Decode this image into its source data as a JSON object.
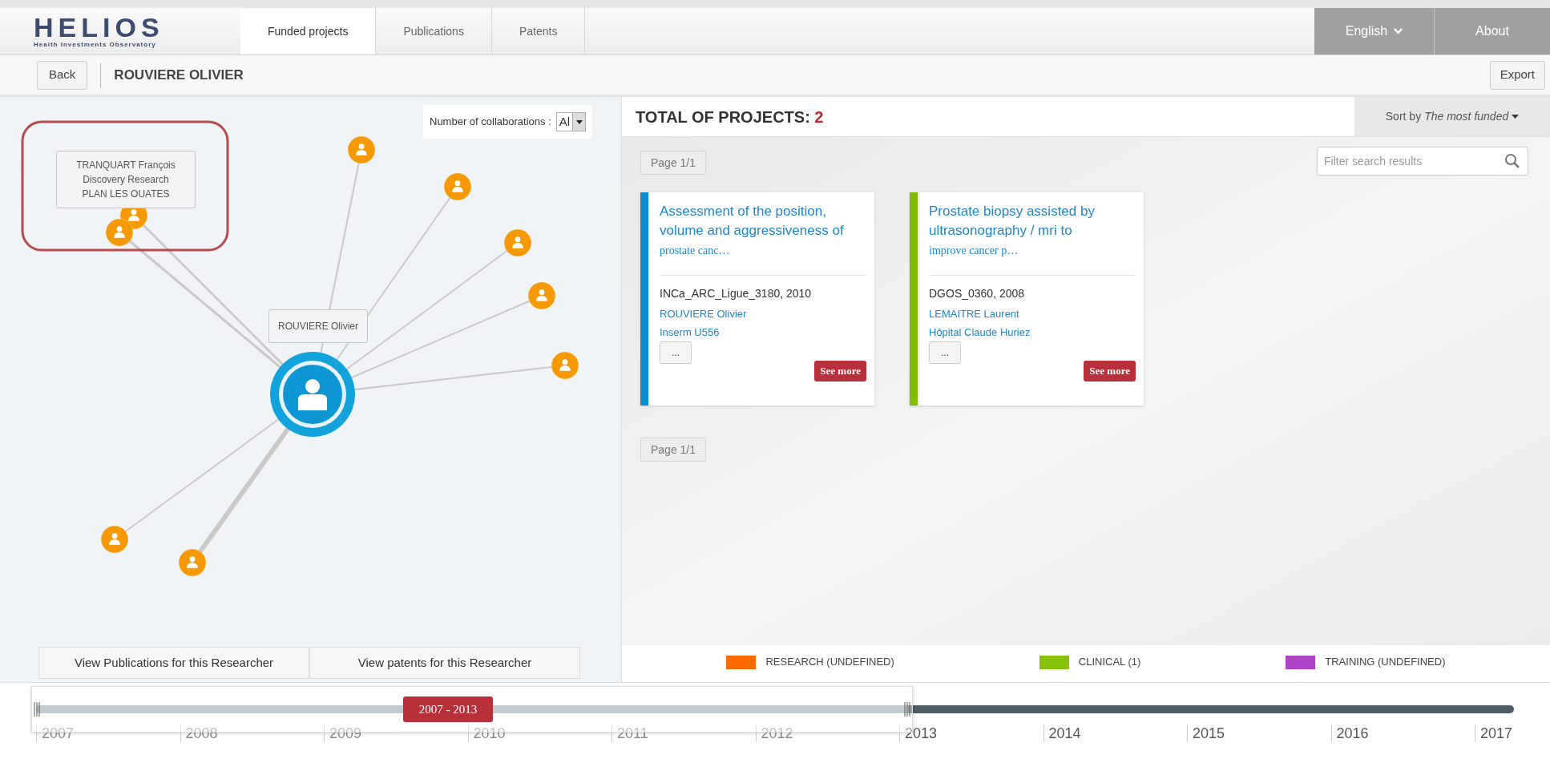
{
  "logo": {
    "name": "HELIOS",
    "tagline": "Health Investments Observatory"
  },
  "tabs": [
    {
      "label": "Funded projects",
      "selected": true
    },
    {
      "label": "Publications",
      "selected": false
    },
    {
      "label": "Patents",
      "selected": false
    }
  ],
  "language": "English",
  "about": "About",
  "subbar": {
    "back": "Back",
    "title": "ROUVIERE OLIVIER",
    "export": "Export"
  },
  "graph": {
    "filter_label": "Number of collaborations :",
    "filter_value": "Al",
    "center_label": "ROUVIERE Olivier",
    "tooltip": [
      "TRANQUART François",
      "Discovery Research",
      "PLAN LES OUATES"
    ]
  },
  "researcher_buttons": [
    "View Publications for this Researcher",
    "View patents for this Researcher"
  ],
  "projects": {
    "total_label": "TOTAL OF PROJECTS:",
    "total": "2",
    "sort_label": "Sort by",
    "sort_value": "The most funded",
    "page": "Page 1/1",
    "page_bottom": "Page 1/1",
    "filter_placeholder": "Filter search results",
    "cards": [
      {
        "title": "Assessment of the position, volume and aggressiveness of",
        "title_more": "prostate canc…",
        "reference": "INCa_ARC_Ligue_3180, 2010",
        "person": "ROUVIERE Olivier",
        "institution": "Inserm U556",
        "more": "...",
        "see_more": "See more",
        "color": "#0a8fd6"
      },
      {
        "title": "Prostate biopsy assisted by ultrasonography / mri to",
        "title_more": "improve cancer p…",
        "reference": "DGOS_0360, 2008",
        "person": "LEMAITRE Laurent",
        "institution": "Hôpital Claude Huriez",
        "more": "...",
        "see_more": "See more",
        "color": "#80bd01"
      }
    ]
  },
  "legend": [
    {
      "label": "RESEARCH (UNDEFINED)",
      "color": "#ff6a00"
    },
    {
      "label": "CLINICAL (1)",
      "color": "#86c20a"
    },
    {
      "label": "TRAINING (UNDEFINED)",
      "color": "#b044c8"
    }
  ],
  "timeline": {
    "range_label": "2007 - 2013",
    "level": 0.59,
    "years": [
      {
        "label": "2007",
        "selected": true
      },
      {
        "label": "2008",
        "selected": true
      },
      {
        "label": "2009",
        "selected": true
      },
      {
        "label": "2010",
        "selected": true
      },
      {
        "label": "2011",
        "selected": true
      },
      {
        "label": "2012",
        "selected": true
      },
      {
        "label": "2013",
        "selected": false
      },
      {
        "label": "2014",
        "selected": false
      },
      {
        "label": "2015",
        "selected": false
      },
      {
        "label": "2016",
        "selected": false
      },
      {
        "label": "2017",
        "selected": false
      }
    ]
  }
}
